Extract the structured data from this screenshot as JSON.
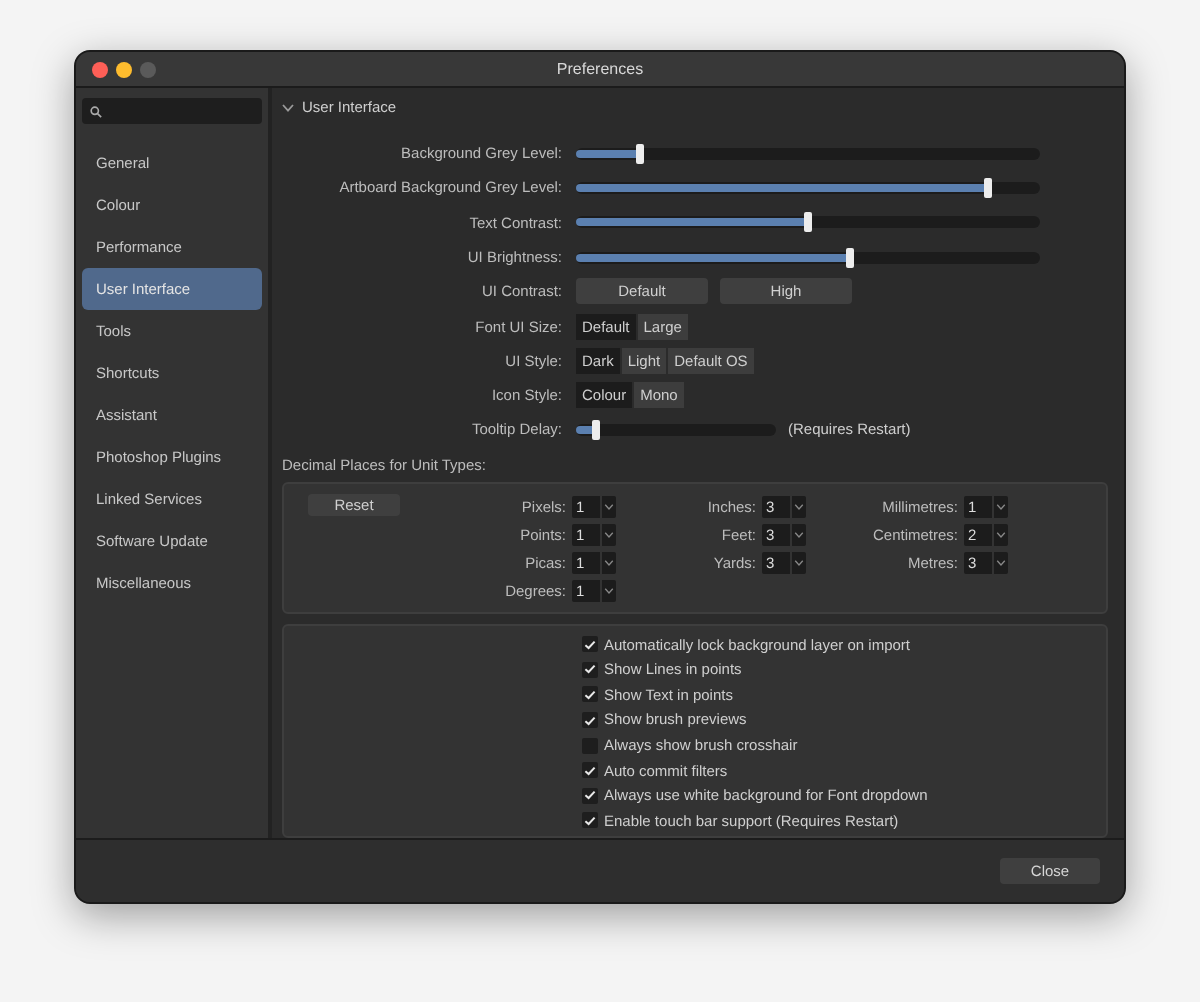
{
  "window": {
    "title": "Preferences"
  },
  "sidebar": {
    "items": [
      {
        "label": "General",
        "selected": false
      },
      {
        "label": "Colour",
        "selected": false
      },
      {
        "label": "Performance",
        "selected": false
      },
      {
        "label": "User Interface",
        "selected": true
      },
      {
        "label": "Tools",
        "selected": false
      },
      {
        "label": "Shortcuts",
        "selected": false
      },
      {
        "label": "Assistant",
        "selected": false
      },
      {
        "label": "Photoshop Plugins",
        "selected": false
      },
      {
        "label": "Linked Services",
        "selected": false
      },
      {
        "label": "Software Update",
        "selected": false
      },
      {
        "label": "Miscellaneous",
        "selected": false
      }
    ]
  },
  "section": {
    "title": "User Interface",
    "expanded": true
  },
  "settings": [
    {
      "kind": "slider",
      "label": "Background Grey Level:",
      "level": 0.14
    },
    {
      "kind": "slider",
      "label": "Artboard Background Grey Level:",
      "level": 0.89
    },
    {
      "kind": "slider",
      "label": "Text Contrast:",
      "level": 0.5
    },
    {
      "kind": "slider",
      "label": "UI Brightness:",
      "level": 0.59
    },
    {
      "kind": "buttons",
      "label": "UI Contrast:",
      "options": [
        {
          "label": "Default",
          "selected": false
        },
        {
          "label": "High",
          "selected": false
        }
      ]
    },
    {
      "kind": "segmented",
      "label": "Font UI Size:",
      "options": [
        {
          "label": "Default",
          "selected": true
        },
        {
          "label": "Large",
          "selected": false
        }
      ]
    },
    {
      "kind": "segmented",
      "label": "UI Style:",
      "options": [
        {
          "label": "Dark",
          "selected": true
        },
        {
          "label": "Light",
          "selected": false
        },
        {
          "label": "Default OS",
          "selected": false
        }
      ]
    },
    {
      "kind": "segmented",
      "label": "Icon Style:",
      "options": [
        {
          "label": "Colour",
          "selected": true
        },
        {
          "label": "Mono",
          "selected": false
        }
      ]
    },
    {
      "kind": "short_slider",
      "label": "Tooltip Delay:",
      "level": 0.1,
      "note": "(Requires Restart)"
    }
  ],
  "decimal_places": {
    "title": "Decimal Places for Unit Types:",
    "reset_button": "Reset",
    "columns": [
      [
        {
          "label": "Pixels:",
          "value": "1"
        },
        {
          "label": "Points:",
          "value": "1"
        },
        {
          "label": "Picas:",
          "value": "1"
        },
        {
          "label": "Degrees:",
          "value": "1"
        }
      ],
      [
        {
          "label": "Inches:",
          "value": "3"
        },
        {
          "label": "Feet:",
          "value": "3"
        },
        {
          "label": "Yards:",
          "value": "3"
        }
      ],
      [
        {
          "label": "Millimetres:",
          "value": "1"
        },
        {
          "label": "Centimetres:",
          "value": "2"
        },
        {
          "label": "Metres:",
          "value": "3"
        }
      ]
    ]
  },
  "options": [
    {
      "label": "Automatically lock background layer on import",
      "checked": true
    },
    {
      "label": "Show Lines in points",
      "checked": true
    },
    {
      "label": "Show Text in points",
      "checked": true
    },
    {
      "label": "Show brush previews",
      "checked": true
    },
    {
      "label": "Always show brush crosshair",
      "checked": false
    },
    {
      "label": "Auto commit filters",
      "checked": true
    },
    {
      "label": "Always use white background for Font dropdown",
      "checked": true
    },
    {
      "label": "Enable touch bar support (Requires Restart)",
      "checked": true
    }
  ],
  "footer_buttons": [
    "Close"
  ]
}
